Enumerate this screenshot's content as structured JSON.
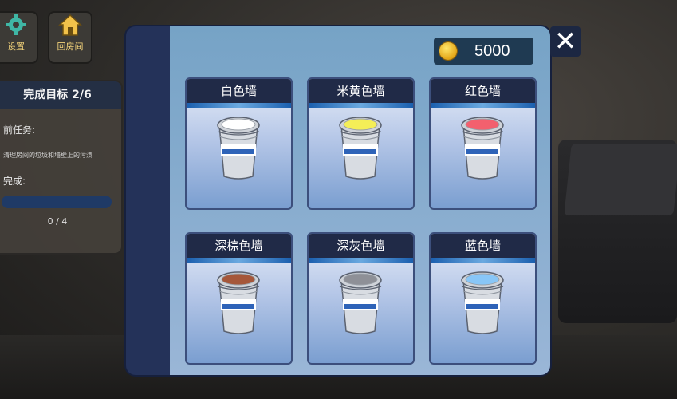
{
  "top_buttons": [
    {
      "label": "设置",
      "icon": "gear-icon"
    },
    {
      "label": "回房间",
      "icon": "home-icon"
    }
  ],
  "task_panel": {
    "title": "完成目标 2/6",
    "task_label": "前任务:",
    "task_desc": "清理房间的垃圾和墙壁上的污渍",
    "complete_label": "完成:",
    "progress_text": "0 / 4",
    "progress": 0
  },
  "shop": {
    "coins": "5000",
    "close": "✕",
    "paints": [
      {
        "name": "白色墙",
        "color": "#ffffff"
      },
      {
        "name": "米黄色墙",
        "color": "#f4ee57"
      },
      {
        "name": "红色墙",
        "color": "#f3606e"
      },
      {
        "name": "深棕色墙",
        "color": "#a5573a"
      },
      {
        "name": "深灰色墙",
        "color": "#8e9097"
      },
      {
        "name": "蓝色墙",
        "color": "#88c6f7"
      }
    ]
  }
}
